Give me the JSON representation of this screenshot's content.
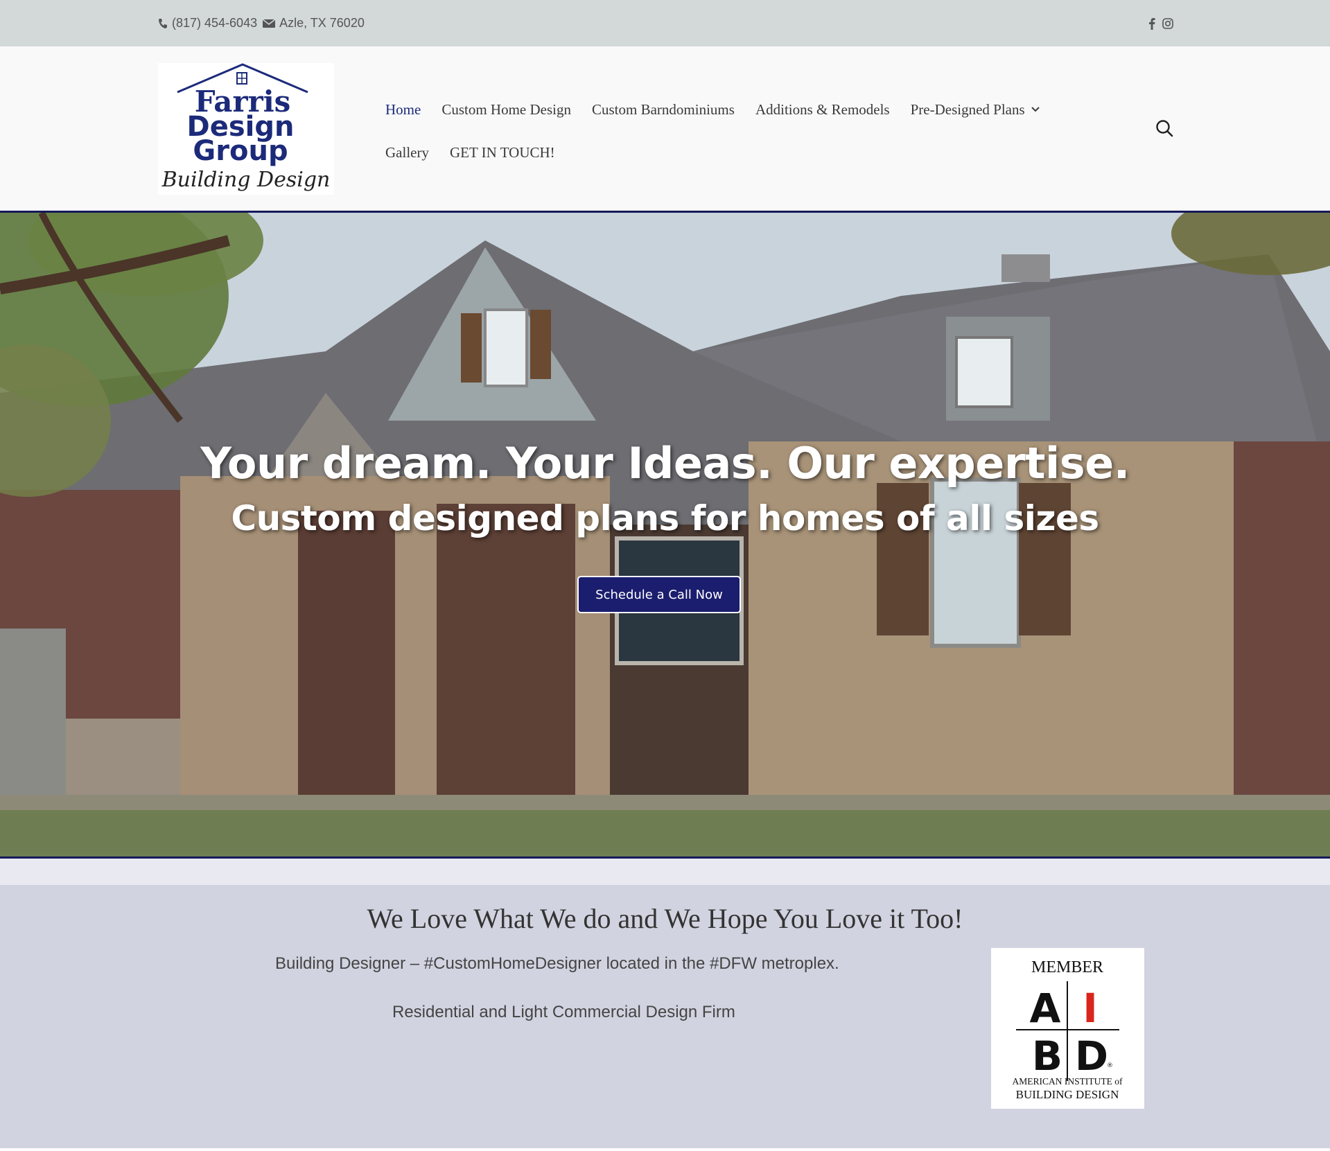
{
  "topbar": {
    "phone": "(817) 454-6043",
    "address": "Azle, TX 76020",
    "icons": {
      "phone": "phone-icon",
      "email": "envelope-icon",
      "facebook": "facebook-icon",
      "instagram": "instagram-icon"
    }
  },
  "logo": {
    "line1": "Farris",
    "line2": "Design",
    "line3": "Group",
    "line4": "Building Design"
  },
  "nav": {
    "items": [
      {
        "label": "Home",
        "active": true
      },
      {
        "label": "Custom Home Design"
      },
      {
        "label": "Custom Barndominiums"
      },
      {
        "label": "Additions & Remodels"
      },
      {
        "label": "Pre-Designed Plans",
        "has_dropdown": true
      },
      {
        "label": "Gallery"
      },
      {
        "label": "GET IN TOUCH!"
      }
    ],
    "search_icon": "search-icon"
  },
  "hero": {
    "title": "Your dream. Your Ideas. Our expertise.",
    "subtitle": "Custom designed plans for homes of all sizes",
    "cta": "Schedule a Call Now"
  },
  "about": {
    "heading": "We Love What We do and We Hope You Love it Too!",
    "line1": "Building Designer – #CustomHomeDesigner located in the #DFW metroplex.",
    "line2": "Residential and Light Commercial Design Firm",
    "badge": {
      "top": "MEMBER",
      "letters": [
        "A",
        "I",
        "B",
        "D"
      ],
      "reg": "®",
      "bottom1": "AMERICAN INSTITUTE of",
      "bottom2": "BUILDING DESIGN"
    }
  },
  "colors": {
    "accent": "#1c2a7a",
    "button": "#1b1d6e",
    "topbar": "#d3d8d8",
    "section_bg": "#d1d3e0"
  }
}
